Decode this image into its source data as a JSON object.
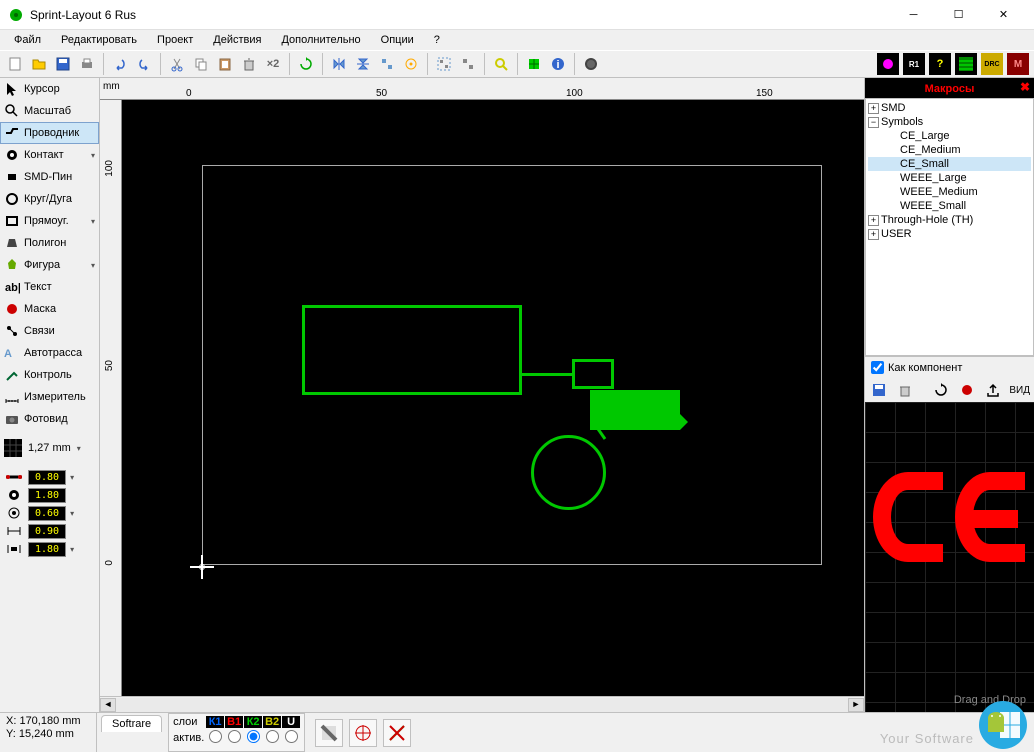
{
  "title": "Sprint-Layout 6 Rus",
  "menu": [
    "Файл",
    "Редактировать",
    "Проект",
    "Действия",
    "Дополнительно",
    "Опции",
    "?"
  ],
  "tools": [
    {
      "icon": "cursor",
      "label": "Курсор",
      "arrow": false
    },
    {
      "icon": "zoom",
      "label": "Масштаб",
      "arrow": false
    },
    {
      "icon": "track",
      "label": "Проводник",
      "arrow": false,
      "active": true
    },
    {
      "icon": "pad",
      "label": "Контакт",
      "arrow": true
    },
    {
      "icon": "smd",
      "label": "SMD-Пин",
      "arrow": false
    },
    {
      "icon": "circle",
      "label": "Круг/Дуга",
      "arrow": false
    },
    {
      "icon": "rect",
      "label": "Прямоуг.",
      "arrow": true
    },
    {
      "icon": "poly",
      "label": "Полигон",
      "arrow": false
    },
    {
      "icon": "shape",
      "label": "Фигура",
      "arrow": true
    },
    {
      "icon": "text",
      "label": "Текст",
      "arrow": false
    },
    {
      "icon": "mask",
      "label": "Маска",
      "arrow": false
    },
    {
      "icon": "link",
      "label": "Связи",
      "arrow": false
    },
    {
      "icon": "auto",
      "label": "Автотрасса",
      "arrow": false
    },
    {
      "icon": "test",
      "label": "Контроль",
      "arrow": false
    },
    {
      "icon": "measure",
      "label": "Измеритель",
      "arrow": false
    },
    {
      "icon": "photo",
      "label": "Фотовид",
      "arrow": false
    }
  ],
  "grid_size": "1,27 mm",
  "params": [
    {
      "icon": "w1",
      "val": "0.80",
      "arrow": true
    },
    {
      "icon": "w2",
      "val": "1.80",
      "arrow": false
    },
    {
      "icon": "w3",
      "val": "0.60",
      "arrow": true
    },
    {
      "icon": "w4",
      "val": "0.90",
      "arrow": false
    },
    {
      "icon": "w5",
      "val": "1.80",
      "arrow": true
    }
  ],
  "ruler": {
    "unit": "mm",
    "ticks_h": [
      "0",
      "50",
      "100",
      "150"
    ],
    "ticks_v": [
      "100",
      "50",
      "0"
    ]
  },
  "macros": {
    "title": "Макросы",
    "tree": {
      "smd": "SMD",
      "symbols": {
        "label": "Symbols",
        "children": [
          "CE_Large",
          "CE_Medium",
          "CE_Small",
          "WEEE_Large",
          "WEEE_Medium",
          "WEEE_Small"
        ]
      },
      "th": "Through-Hole (TH)",
      "user": "USER"
    },
    "as_component": "Как компонент",
    "export_label": "ВИД",
    "drag_drop": "Drag and Drop"
  },
  "status": {
    "x": "X: 170,180 mm",
    "y": "Y:  15,240 mm",
    "tab": "Softrare",
    "layers_label": "слои",
    "active_label": "актив.",
    "layers": [
      "К1",
      "В1",
      "К2",
      "В2",
      "U"
    ],
    "layer_colors": [
      "#00f",
      "#f00",
      "#0c0",
      "#cc0",
      "#fff"
    ]
  },
  "watermark": "Your Software"
}
